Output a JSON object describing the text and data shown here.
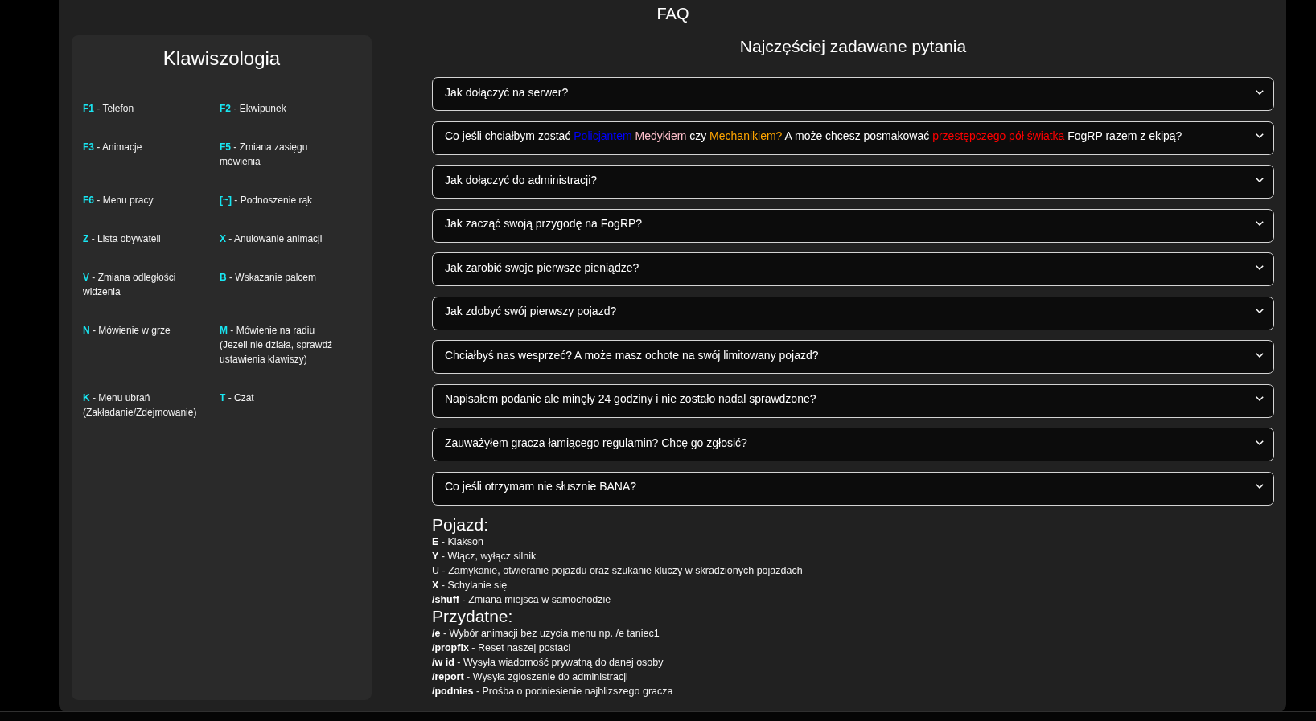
{
  "header": {
    "title": "FAQ"
  },
  "keybinds": {
    "title": "Klawiszologia",
    "items": [
      "**F1** - Telefon",
      "**F2** - Ekwipunek",
      "**F3** - Animacje",
      "**F5** - Zmiana zasięgu mówienia",
      "**F6** - Menu pracy",
      "**[~]** - Podnoszenie rąk",
      "**Z** - Lista obywateli",
      "**X** - Anulowanie animacji",
      "**V** - Zmiana odległości widzenia",
      "**B** - Wskazanie palcem",
      "**N** - Mówienie w grze",
      "**M** - Mówienie na radiu (Jezeli nie działa, sprawdź ustawienia klawiszy)",
      "**K** - Menu ubrań (Zakładanie/Zdejmowanie)",
      "**T** - Czat"
    ]
  },
  "faq": {
    "title": "Najczęściej zadawane pytania",
    "questions": [
      {
        "text": "Jak dołączyć na serwer?",
        "expanded": false
      },
      {
        "parts": [
          {
            "text": "Co jeśli chciałbym zostać"
          },
          {
            "text": "Policjantem",
            "color": "#0000ff"
          },
          {
            "text": "Medykiem",
            "color": "#ffc0cb"
          },
          {
            "text": "czy"
          },
          {
            "text": "Mechanikiem?",
            "color": "#ffa500"
          },
          {
            "text": "A może chcesz posmakować"
          },
          {
            "text": "przestępczego pół światka",
            "color": "#ff0000"
          },
          {
            "text": "FogRP razem z ekipą?"
          }
        ],
        "expanded": false
      },
      {
        "text": "Jak dołączyć do administracji?",
        "expanded": false
      },
      {
        "text": "Jak zacząć swoją przygodę na FogRP?",
        "expanded": false
      },
      {
        "text": "Jak zarobić swoje pierwsze pieniądze?",
        "expanded": false
      },
      {
        "text": "Jak zdobyć swój pierwszy pojazd?",
        "expanded": false
      },
      {
        "text": "Chciałbyś nas wesprzeć? A może masz ochote na swój limitowany pojazd?",
        "expanded": false
      },
      {
        "text": "Napisałem podanie ale minęły 24 godziny i nie zostało nadal sprawdzone?",
        "expanded": false
      },
      {
        "text": "Zauważyłem gracza łamiącego regulamin? Chcę go zgłosić?",
        "expanded": false
      },
      {
        "text": "Co jeśli otrzymam nie słusznie BANA?",
        "expanded": false
      }
    ]
  },
  "sections": [
    {
      "title": "Pojazd:",
      "lines": [
        "**E** - Klakson",
        "**Y** - Włącz, wyłącz silnik",
        "U - Zamykanie, otwieranie pojazdu oraz szukanie kluczy w skradzionych pojazdach",
        "**X** - Schylanie się",
        "**/shuff** - Zmiana miejsca w samochodzie"
      ]
    },
    {
      "title": "Przydatne:",
      "lines": [
        "**/e** - Wybór animacji bez uzycia menu np. /e taniec1",
        "**/propfix** - Reset naszej postaci",
        "**/w id** - Wysyła wiadomość prywatną do danej osoby",
        "**/report** - Wysyła zgloszenie do administracji",
        "**/podnies** - Prośba o podniesienie najblizszego gracza"
      ]
    }
  ]
}
